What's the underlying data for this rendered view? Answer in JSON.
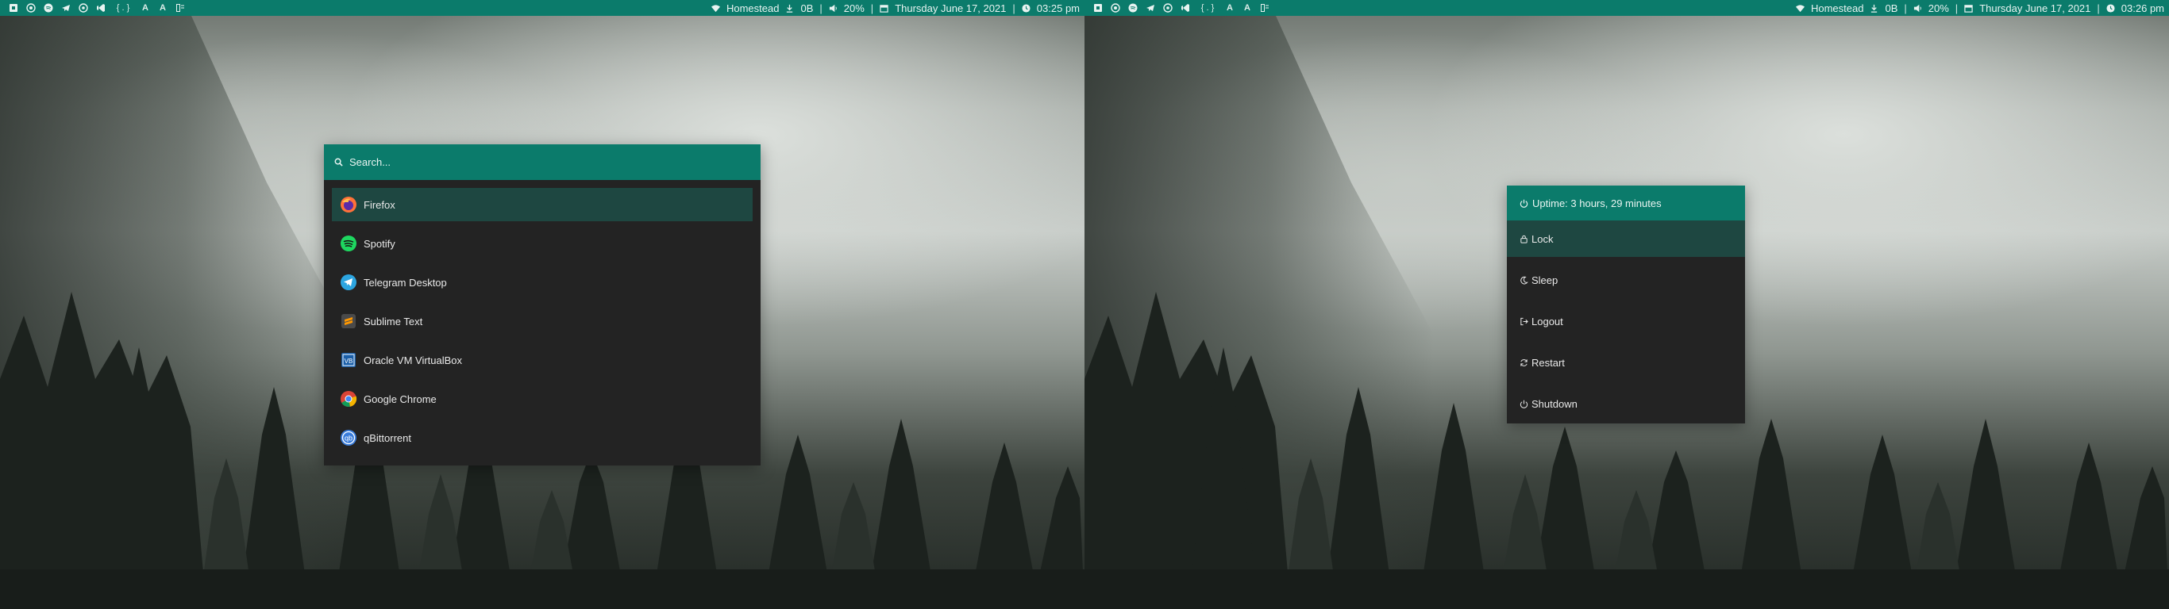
{
  "colors": {
    "accent": "#0b7b6b",
    "panel_bg": "#232323",
    "selected_bg": "#1e4741",
    "text": "#e9e9e9"
  },
  "topbar_left": {
    "launchers": [
      {
        "icon": "app-icon"
      },
      {
        "icon": "firefox-icon"
      },
      {
        "icon": "spotify-icon"
      },
      {
        "icon": "telegram-icon"
      },
      {
        "icon": "chrome-icon"
      },
      {
        "icon": "vscode-icon"
      },
      {
        "icon": "braces-icon",
        "label": "{ . }"
      },
      {
        "icon": "font-icon",
        "label": "A"
      },
      {
        "icon": "font-icon",
        "label": "A"
      },
      {
        "icon": "files-icon"
      }
    ],
    "status": {
      "wifi": "Homestead",
      "download": "0B",
      "volume": "20%",
      "date": "Thursday June 17, 2021",
      "time": "03:25 pm"
    }
  },
  "topbar_right": {
    "status": {
      "wifi": "Homestead",
      "download": "0B",
      "volume": "20%",
      "date": "Thursday June 17, 2021",
      "time": "03:26 pm"
    }
  },
  "launcher": {
    "search_placeholder": "Search...",
    "selected_index": 0,
    "items": [
      {
        "label": "Firefox",
        "icon": "firefox-icon"
      },
      {
        "label": "Spotify",
        "icon": "spotify-icon"
      },
      {
        "label": "Telegram Desktop",
        "icon": "telegram-icon"
      },
      {
        "label": "Sublime Text",
        "icon": "sublime-icon"
      },
      {
        "label": "Oracle VM VirtualBox",
        "icon": "virtualbox-icon"
      },
      {
        "label": "Google Chrome",
        "icon": "chrome-icon"
      },
      {
        "label": "qBittorrent",
        "icon": "qbittorrent-icon"
      }
    ]
  },
  "power_menu": {
    "uptime": "Uptime: 3 hours, 29 minutes",
    "selected_index": 0,
    "options": [
      {
        "label": "Lock",
        "icon": "lock-icon"
      },
      {
        "label": "Sleep",
        "icon": "moon-icon"
      },
      {
        "label": "Logout",
        "icon": "logout-icon"
      },
      {
        "label": "Restart",
        "icon": "restart-icon"
      },
      {
        "label": "Shutdown",
        "icon": "power-icon"
      }
    ]
  }
}
